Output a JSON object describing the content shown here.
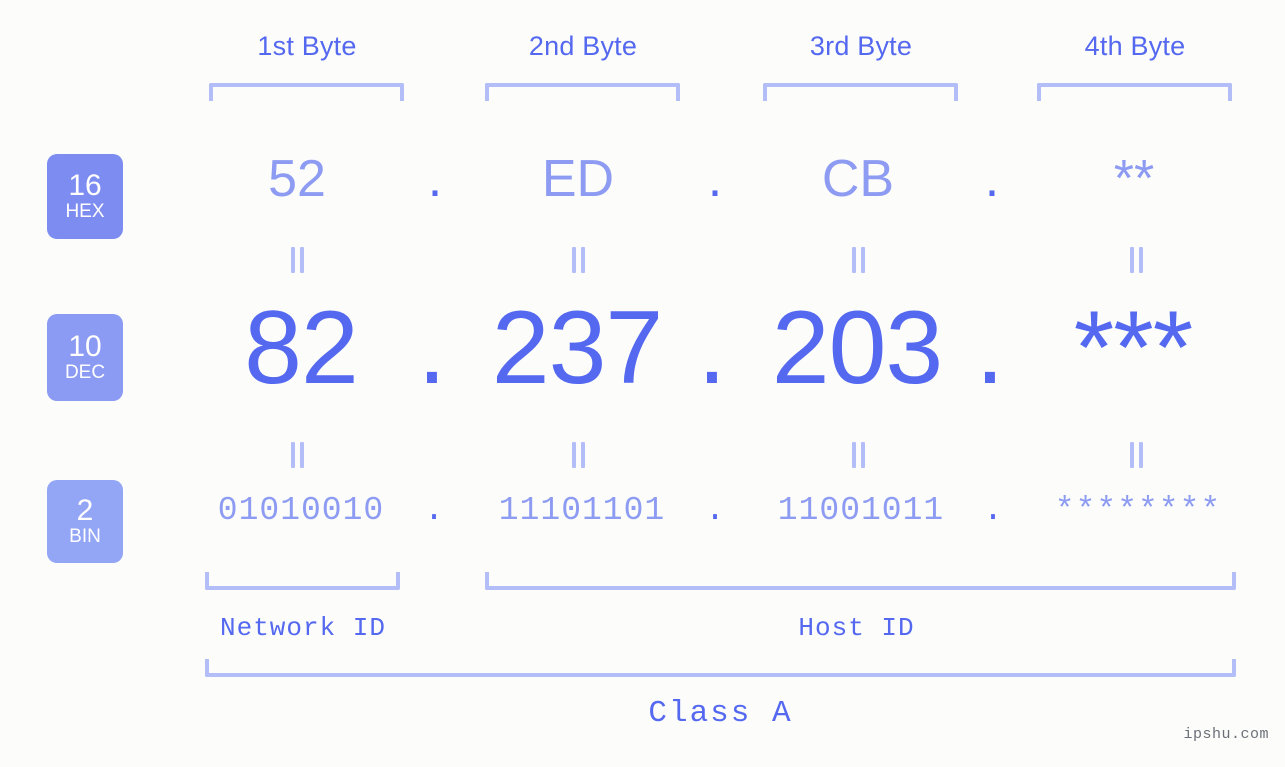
{
  "background_color": "#fcfdfa",
  "accent_color": "#5468f0",
  "muted_color": "#8d9cf2",
  "rule_color": "#b3bef8",
  "byte_headers": [
    {
      "label": "1st Byte"
    },
    {
      "label": "2nd Byte"
    },
    {
      "label": "3rd Byte"
    },
    {
      "label": "4th Byte"
    }
  ],
  "radix_badges": [
    {
      "number": "16",
      "name": "HEX",
      "color": "#7c8cf0"
    },
    {
      "number": "10",
      "name": "DEC",
      "color": "#8b9af2"
    },
    {
      "number": "2",
      "name": "BIN",
      "color": "#93a5f5"
    }
  ],
  "rows": {
    "hex": {
      "bytes": [
        "52",
        "ED",
        "CB",
        "**"
      ],
      "separator": "."
    },
    "dec": {
      "bytes": [
        "82",
        "237",
        "203",
        "***"
      ],
      "separator": "."
    },
    "bin": {
      "bytes": [
        "01010010",
        "11101101",
        "11001011",
        "********"
      ],
      "separator": "."
    }
  },
  "equivalence_symbol": "=",
  "sections": [
    {
      "label": "Network ID"
    },
    {
      "label": "Host ID"
    }
  ],
  "class": {
    "label": "Class A"
  },
  "watermark": {
    "text": "ipshu.com"
  }
}
